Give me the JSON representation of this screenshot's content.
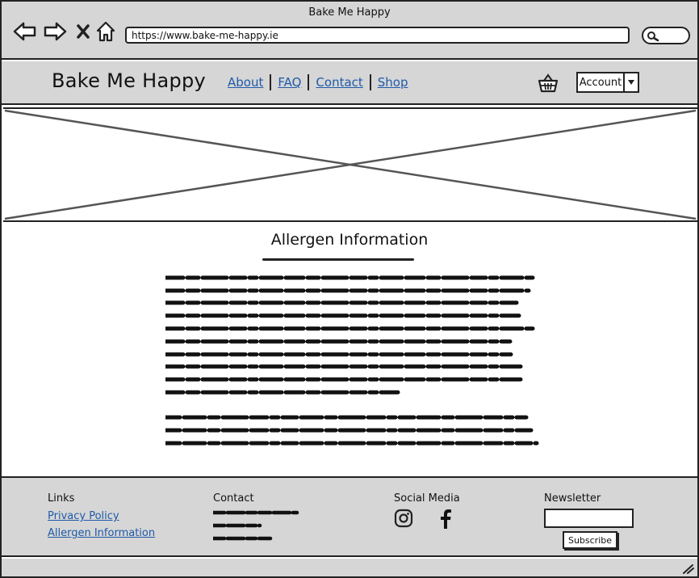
{
  "browser": {
    "window_title": "Bake Me Happy",
    "url": "https://www.bake-me-happy.ie",
    "icons": [
      "back-arrow-icon",
      "forward-arrow-icon",
      "close-icon",
      "home-icon",
      "search-icon"
    ]
  },
  "header": {
    "brand": "Bake Me Happy",
    "nav": [
      {
        "label": "About"
      },
      {
        "label": "FAQ"
      },
      {
        "label": "Contact"
      },
      {
        "label": "Shop"
      }
    ],
    "cart_icon": "basket-icon",
    "account_label": "Account"
  },
  "hero": {
    "type": "image-placeholder"
  },
  "main": {
    "title": "Allergen Information"
  },
  "footer": {
    "links_heading": "Links",
    "links": [
      {
        "label": "Privacy Policy"
      },
      {
        "label": "Allergen Information"
      }
    ],
    "contact_heading": "Contact",
    "social_heading": "Social Media",
    "social_icons": [
      "instagram-icon",
      "facebook-icon"
    ],
    "newsletter_heading": "Newsletter",
    "subscribe_label": "Subscribe"
  },
  "colors": {
    "chrome": "#d6d6d6",
    "link": "#1e5aa8",
    "outline": "#222222"
  }
}
